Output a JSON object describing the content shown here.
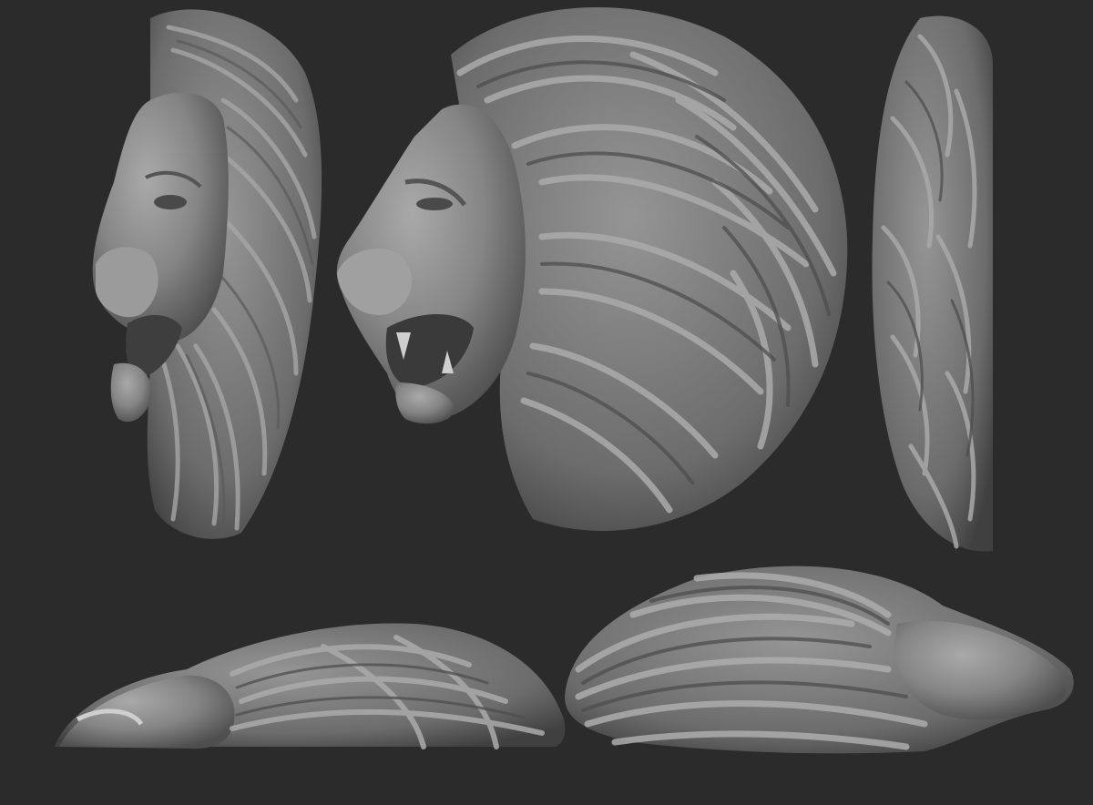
{
  "scene": {
    "background_color": "#2b2b2b",
    "subject": "lion-head-sculpt",
    "material_color": "#8c8c8c",
    "views": [
      {
        "id": "three-quarter-view"
      },
      {
        "id": "side-view"
      },
      {
        "id": "back-view"
      },
      {
        "id": "bottom-view-left"
      },
      {
        "id": "bottom-view-right"
      }
    ]
  }
}
